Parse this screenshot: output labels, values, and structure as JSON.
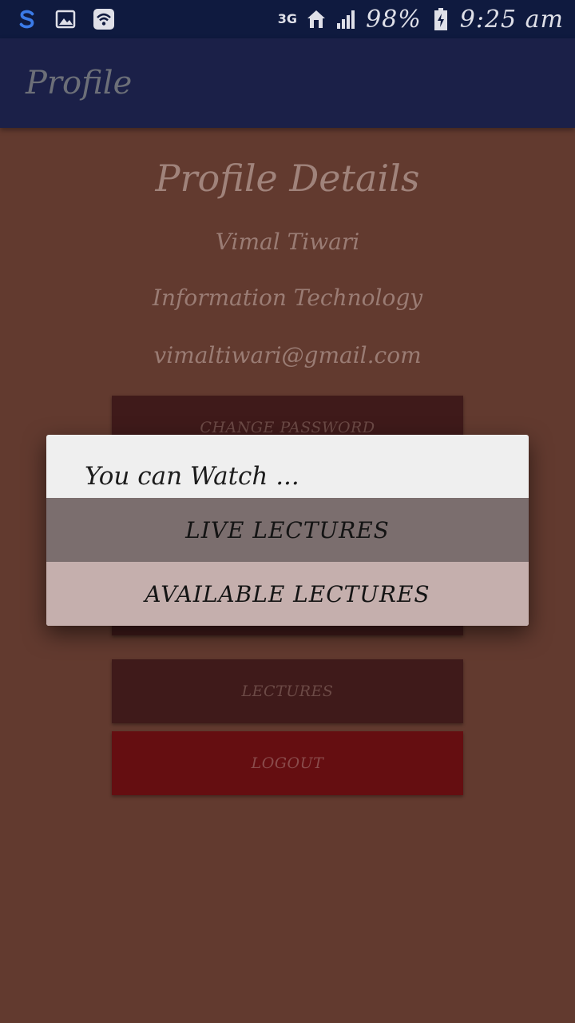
{
  "status_bar": {
    "network": "3G",
    "battery": "98%",
    "time": "9:25 am",
    "icons": [
      "s-app-icon",
      "gallery-icon",
      "wifi-icon",
      "network-3g-icon",
      "home-icon",
      "signal-icon",
      "battery-icon"
    ]
  },
  "appbar": {
    "title": "Profile"
  },
  "profile": {
    "heading": "Profile Details",
    "name": "Vimal Tiwari",
    "department": "Information Technology",
    "email": "vimaltiwari@gmail.com"
  },
  "buttons": {
    "change_password": "CHANGE PASSWORD",
    "lectures": "LECTURES",
    "logout": "LOGOUT"
  },
  "dialog": {
    "title": "You can Watch ...",
    "options": [
      "LIVE LECTURES",
      "AVAILABLE LECTURES"
    ]
  },
  "colors": {
    "status_bar": "#0f1a3f",
    "app_bar": "#1b2048",
    "background": "#623a2f",
    "button": "#3f1a1a",
    "logout_button": "#650e11",
    "dialog_option_1": "#7b6e6e",
    "dialog_option_2": "#c5afad"
  }
}
